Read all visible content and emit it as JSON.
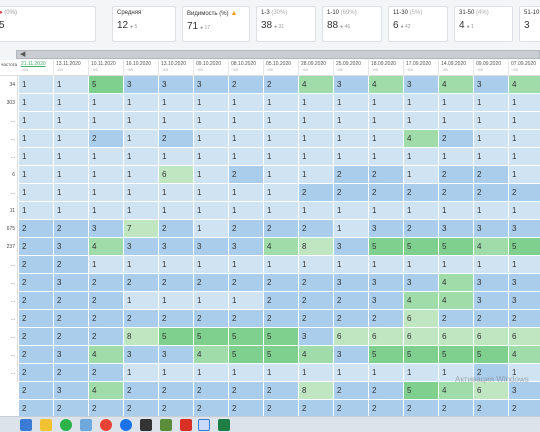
{
  "cards": [
    {
      "label": "(0%)",
      "value": "5",
      "sub": "",
      "muted": true,
      "icon": "red-circle-icon"
    },
    {
      "label": "Средняя",
      "value": "12",
      "sub": "5",
      "muted": false,
      "icon": ""
    },
    {
      "label": "Видимость (%)",
      "value": "71",
      "sub": "17",
      "muted": false,
      "icon": "warning-icon"
    },
    {
      "label": "1-3",
      "pct": "(30%)",
      "value": "38",
      "sub": "31",
      "muted": false
    },
    {
      "label": "1-10",
      "pct": "(69%)",
      "value": "88",
      "sub": "46",
      "muted": false
    },
    {
      "label": "11-30",
      "pct": "(5%)",
      "value": "6",
      "sub": "42",
      "muted": false
    },
    {
      "label": "31-50",
      "pct": "(4%)",
      "value": "4",
      "sub": "1",
      "muted": false
    },
    {
      "label": "51-10",
      "pct": "",
      "value": "3",
      "sub": "",
      "muted": false
    }
  ],
  "header": {
    "left_label": "частота",
    "dates": [
      "21.11.2020",
      "13.11.2020",
      "10.11.2020",
      "16.10.2020",
      "13.10.2020",
      "09.10.2020",
      "08.10.2020",
      "05.10.2020",
      "28.09.2020",
      "25.09.2020",
      "18.09.2020",
      "17.09.2020",
      "14.09.2020",
      "09.09.2020",
      "07.09.2020"
    ],
    "counts": [
      "65",
      "65",
      "65",
      "65",
      "65",
      "65",
      "65",
      "65",
      "65",
      "65",
      "65",
      "65",
      "65",
      "65",
      "65"
    ]
  },
  "left_col": [
    "34",
    "303",
    "...",
    "...",
    "...",
    "6",
    "...",
    "11",
    "675",
    "237",
    "...",
    "...",
    "...",
    "...",
    "...",
    "...",
    "..."
  ],
  "rows": [
    [
      "1",
      "1",
      "5",
      "3",
      "3",
      "3",
      "2",
      "2",
      "4",
      "3",
      "4",
      "3",
      "4",
      "3",
      "4"
    ],
    [
      "1",
      "1",
      "1",
      "1",
      "1",
      "1",
      "1",
      "1",
      "1",
      "1",
      "1",
      "1",
      "1",
      "1",
      "1"
    ],
    [
      "1",
      "1",
      "1",
      "1",
      "1",
      "1",
      "1",
      "1",
      "1",
      "1",
      "1",
      "1",
      "1",
      "1",
      "1"
    ],
    [
      "1",
      "1",
      "2",
      "1",
      "2",
      "1",
      "1",
      "1",
      "1",
      "1",
      "1",
      "4",
      "2",
      "1",
      "1"
    ],
    [
      "1",
      "1",
      "1",
      "1",
      "1",
      "1",
      "1",
      "1",
      "1",
      "1",
      "1",
      "1",
      "1",
      "1",
      "1"
    ],
    [
      "1",
      "1",
      "1",
      "1",
      "6",
      "1",
      "2",
      "1",
      "1",
      "2",
      "2",
      "1",
      "2",
      "2",
      "1"
    ],
    [
      "1",
      "1",
      "1",
      "1",
      "1",
      "1",
      "1",
      "1",
      "2",
      "2",
      "2",
      "2",
      "2",
      "2",
      "2"
    ],
    [
      "1",
      "1",
      "1",
      "1",
      "1",
      "1",
      "1",
      "1",
      "1",
      "1",
      "1",
      "1",
      "1",
      "1",
      "1"
    ],
    [
      "2",
      "2",
      "3",
      "7",
      "2",
      "1",
      "2",
      "2",
      "2",
      "1",
      "3",
      "2",
      "3",
      "3",
      "3"
    ],
    [
      "2",
      "3",
      "4",
      "3",
      "3",
      "3",
      "3",
      "4",
      "8",
      "3",
      "5",
      "5",
      "5",
      "4",
      "5"
    ],
    [
      "2",
      "2",
      "1",
      "1",
      "1",
      "1",
      "1",
      "1",
      "1",
      "1",
      "1",
      "1",
      "1",
      "1",
      "1"
    ],
    [
      "2",
      "3",
      "2",
      "2",
      "2",
      "2",
      "2",
      "2",
      "2",
      "3",
      "3",
      "3",
      "4",
      "3",
      "3"
    ],
    [
      "2",
      "2",
      "2",
      "1",
      "1",
      "1",
      "1",
      "2",
      "2",
      "2",
      "3",
      "4",
      "4",
      "3",
      "3"
    ],
    [
      "2",
      "2",
      "2",
      "2",
      "2",
      "2",
      "2",
      "2",
      "2",
      "2",
      "2",
      "6",
      "2",
      "2",
      "2"
    ],
    [
      "2",
      "2",
      "2",
      "8",
      "5",
      "5",
      "5",
      "5",
      "3",
      "6",
      "6",
      "6",
      "6",
      "6",
      "6"
    ],
    [
      "2",
      "3",
      "4",
      "3",
      "3",
      "4",
      "5",
      "5",
      "4",
      "3",
      "5",
      "5",
      "5",
      "5",
      "4"
    ],
    [
      "2",
      "2",
      "2",
      "1",
      "1",
      "1",
      "1",
      "1",
      "1",
      "1",
      "1",
      "1",
      "1",
      "2",
      "1"
    ],
    [
      "2",
      "3",
      "4",
      "2",
      "2",
      "2",
      "2",
      "2",
      "8",
      "2",
      "2",
      "5",
      "4",
      "6",
      "3"
    ],
    [
      "2",
      "2",
      "2",
      "2",
      "2",
      "2",
      "2",
      "2",
      "2",
      "2",
      "2",
      "2",
      "2",
      "2",
      "2"
    ]
  ],
  "watermark": "Активация Windows",
  "colors": {
    "light": "#cfe3f3",
    "mid": "#a9cdea",
    "green": "#9fdcaa",
    "green_dark": "#7fd08f",
    "pale_green": "#bfe6c0"
  }
}
